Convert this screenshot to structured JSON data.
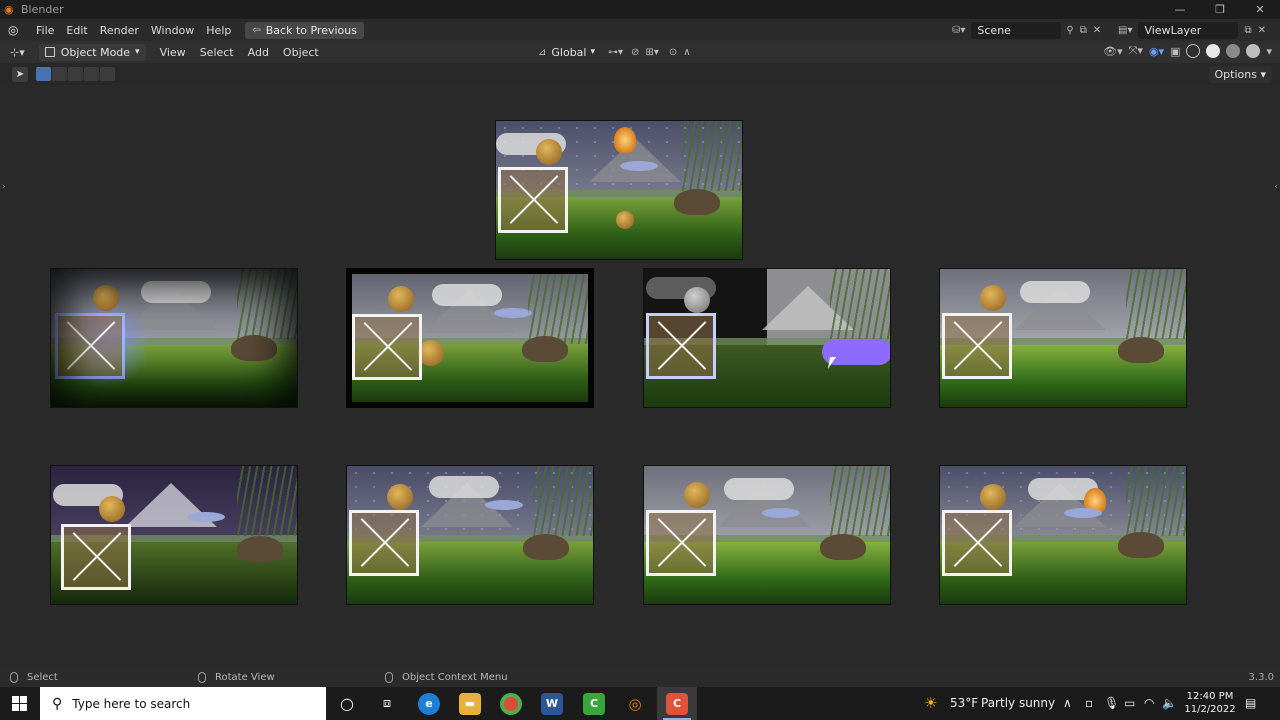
{
  "window": {
    "title": "Blender"
  },
  "menu": {
    "items": [
      "File",
      "Edit",
      "Render",
      "Window",
      "Help"
    ],
    "back_button": "Back to Previous",
    "scene": "Scene",
    "view_layer": "ViewLayer"
  },
  "header": {
    "mode": "Object Mode",
    "items": [
      "View",
      "Select",
      "Add",
      "Object"
    ],
    "orientation": "Global"
  },
  "toolbar": {
    "options": "Options"
  },
  "statusbar": {
    "select": "Select",
    "rotate": "Rotate View",
    "context_menu": "Object Context Menu",
    "version": "3.3.0"
  },
  "taskbar": {
    "search_placeholder": "Type here to search",
    "weather_temp": "53°F",
    "weather_text": "Partly sunny",
    "time": "12:40 PM",
    "date": "11/2/2022"
  },
  "colors": {
    "accent": "#4772b3",
    "blender_orange": "#e87d0d"
  }
}
